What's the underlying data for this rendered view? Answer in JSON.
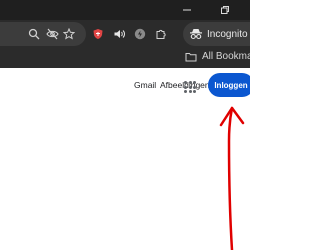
{
  "browser": {
    "incognito_label": "Incognito",
    "bookmarks_label": "All Bookmarks",
    "icons": [
      "search-icon",
      "eye-off-icon",
      "star-icon",
      "shield-icon",
      "speaker-icon",
      "extension-badge-icon",
      "puzzle-icon",
      "incognito-icon",
      "folder-icon",
      "minimize-icon",
      "restore-icon"
    ]
  },
  "page": {
    "gmail_label": "Gmail",
    "images_label": "Afbeeldingen",
    "signin_label": "Inloggen",
    "accent_color": "#0b57d0",
    "annotation_color": "#e00000"
  }
}
